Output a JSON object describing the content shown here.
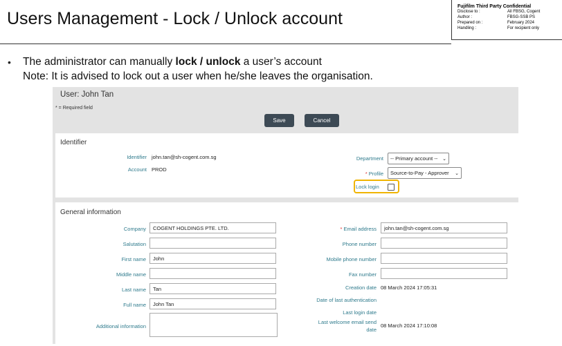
{
  "slide": {
    "title": "Users Management - Lock / Unlock account",
    "confidential": {
      "heading": "Fujifilm Third Party Confidential",
      "rows": [
        {
          "label": "Disclose to :",
          "value": "All FBSG, Cogent"
        },
        {
          "label": "Author :",
          "value": "FBSG-SSB PS"
        },
        {
          "label": "Prepared on :",
          "value": "February 2024"
        },
        {
          "label": "Handling :",
          "value": "For recipient only"
        }
      ]
    },
    "bullet": {
      "pre": "The administrator can manually ",
      "bold1": "lock",
      "sep": " / ",
      "bold2": "unlock",
      "post": " a user’s account",
      "note": "Note: It is advised to lock out a user when he/she leaves the organisation."
    }
  },
  "form": {
    "user_title": "User: John Tan",
    "required_note": "* = Required field",
    "save_label": "Save",
    "cancel_label": "Cancel",
    "identifier_section": {
      "title": "Identifier",
      "identifier_label": "Identifier",
      "identifier_value": "john.tan@sh-cogent.com.sg",
      "account_label": "Account",
      "account_value": "PROD",
      "department_label": "Department",
      "department_value": "-- Primary account --",
      "profile_star": "*",
      "profile_label": "Profile",
      "profile_value": "Source-to-Pay - Approver",
      "lock_login_label": "Lock login"
    },
    "general_section": {
      "title": "General information",
      "left_fields": [
        {
          "label": "Company",
          "value": "COGENT HOLDINGS PTE. LTD."
        },
        {
          "label": "Salutation",
          "value": ""
        },
        {
          "label": "First name",
          "value": "John"
        },
        {
          "label": "Middle name",
          "value": ""
        },
        {
          "label": "Last name",
          "value": "Tan"
        },
        {
          "label": "Full name",
          "value": "John Tan"
        }
      ],
      "additional_info_label": "Additional information",
      "additional_info_value": "",
      "email_star": "*",
      "email_label": "Email address",
      "email_value": "john.tan@sh-cogent.com.sg",
      "phone_label": "Phone number",
      "phone_value": "",
      "mobile_label": "Mobile phone number",
      "mobile_value": "",
      "fax_label": "Fax number",
      "fax_value": "",
      "creation_label": "Creation date",
      "creation_value": "08 March 2024 17:05:31",
      "last_auth_label": "Date of last authentication",
      "last_auth_value": "",
      "last_login_label": "Last login date",
      "last_login_value": "",
      "welcome_label_1": "Last welcome email send",
      "welcome_label_2": "date",
      "welcome_value": "08 March 2024 17:10:08"
    }
  },
  "colors": {
    "label_teal": "#2e7a8c",
    "button_dark": "#3d4a55",
    "highlight_yellow": "#f0b400",
    "required_red": "#d33333"
  }
}
